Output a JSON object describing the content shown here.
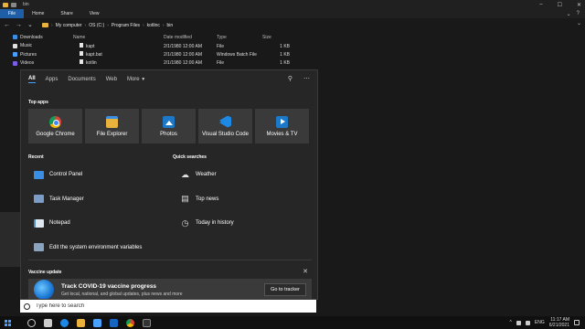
{
  "explorer": {
    "title": "bin",
    "ribbon_tabs": [
      "File",
      "Home",
      "Share",
      "View"
    ],
    "breadcrumb": [
      "My computer",
      "OS (C:)",
      "Program Files",
      "kotlinc",
      "bin"
    ],
    "nav_items": [
      {
        "label": "Downloads",
        "icon": "download-icon",
        "color": "#3a8ee6"
      },
      {
        "label": "Music",
        "icon": "music-icon",
        "color": "#e0e0e0"
      },
      {
        "label": "Pictures",
        "icon": "pictures-icon",
        "color": "#4aa0ff"
      },
      {
        "label": "Videos",
        "icon": "videos-icon",
        "color": "#7a5ee6"
      }
    ],
    "columns": {
      "name": "Name",
      "date": "Date modified",
      "type": "Type",
      "size": "Size"
    },
    "files": [
      {
        "name": "kapt",
        "date": "2/1/1980 12:00 AM",
        "type": "File",
        "size": "1 KB"
      },
      {
        "name": "kapt.bat",
        "date": "2/1/1980 12:00 AM",
        "type": "Windows Batch File",
        "size": "1 KB"
      },
      {
        "name": "kotlin",
        "date": "2/1/1980 12:00 AM",
        "type": "File",
        "size": "1 KB"
      }
    ]
  },
  "search_panel": {
    "tabs": [
      "All",
      "Apps",
      "Documents",
      "Web",
      "More"
    ],
    "top_apps_heading": "Top apps",
    "top_apps": [
      {
        "label": "Google Chrome",
        "icon": "chrome-icon"
      },
      {
        "label": "File Explorer",
        "icon": "file-explorer-icon"
      },
      {
        "label": "Photos",
        "icon": "photos-icon"
      },
      {
        "label": "Visual Studio Code",
        "icon": "vscode-icon"
      },
      {
        "label": "Movies & TV",
        "icon": "movies-tv-icon"
      }
    ],
    "recent_heading": "Recent",
    "recent": [
      {
        "label": "Control Panel",
        "icon": "control-panel-icon"
      },
      {
        "label": "Task Manager",
        "icon": "task-manager-icon"
      },
      {
        "label": "Notepad",
        "icon": "notepad-icon"
      },
      {
        "label": "Edit the system environment variables",
        "icon": "settings-monitor-icon"
      }
    ],
    "quick_heading": "Quick searches",
    "quick": [
      {
        "label": "Weather",
        "icon": "weather-icon"
      },
      {
        "label": "Top news",
        "icon": "news-icon"
      },
      {
        "label": "Today in history",
        "icon": "history-icon"
      }
    ],
    "vaccine": {
      "heading": "Vaccine update",
      "title": "Track COVID-19 vaccine progress",
      "subtitle": "Get local, national, and global updates, plus news and more",
      "button": "Go to tracker"
    }
  },
  "searchbox": {
    "placeholder": "Type here to search"
  },
  "tray": {
    "language": "ENG",
    "time": "11:17 AM",
    "date": "6/21/2021"
  }
}
